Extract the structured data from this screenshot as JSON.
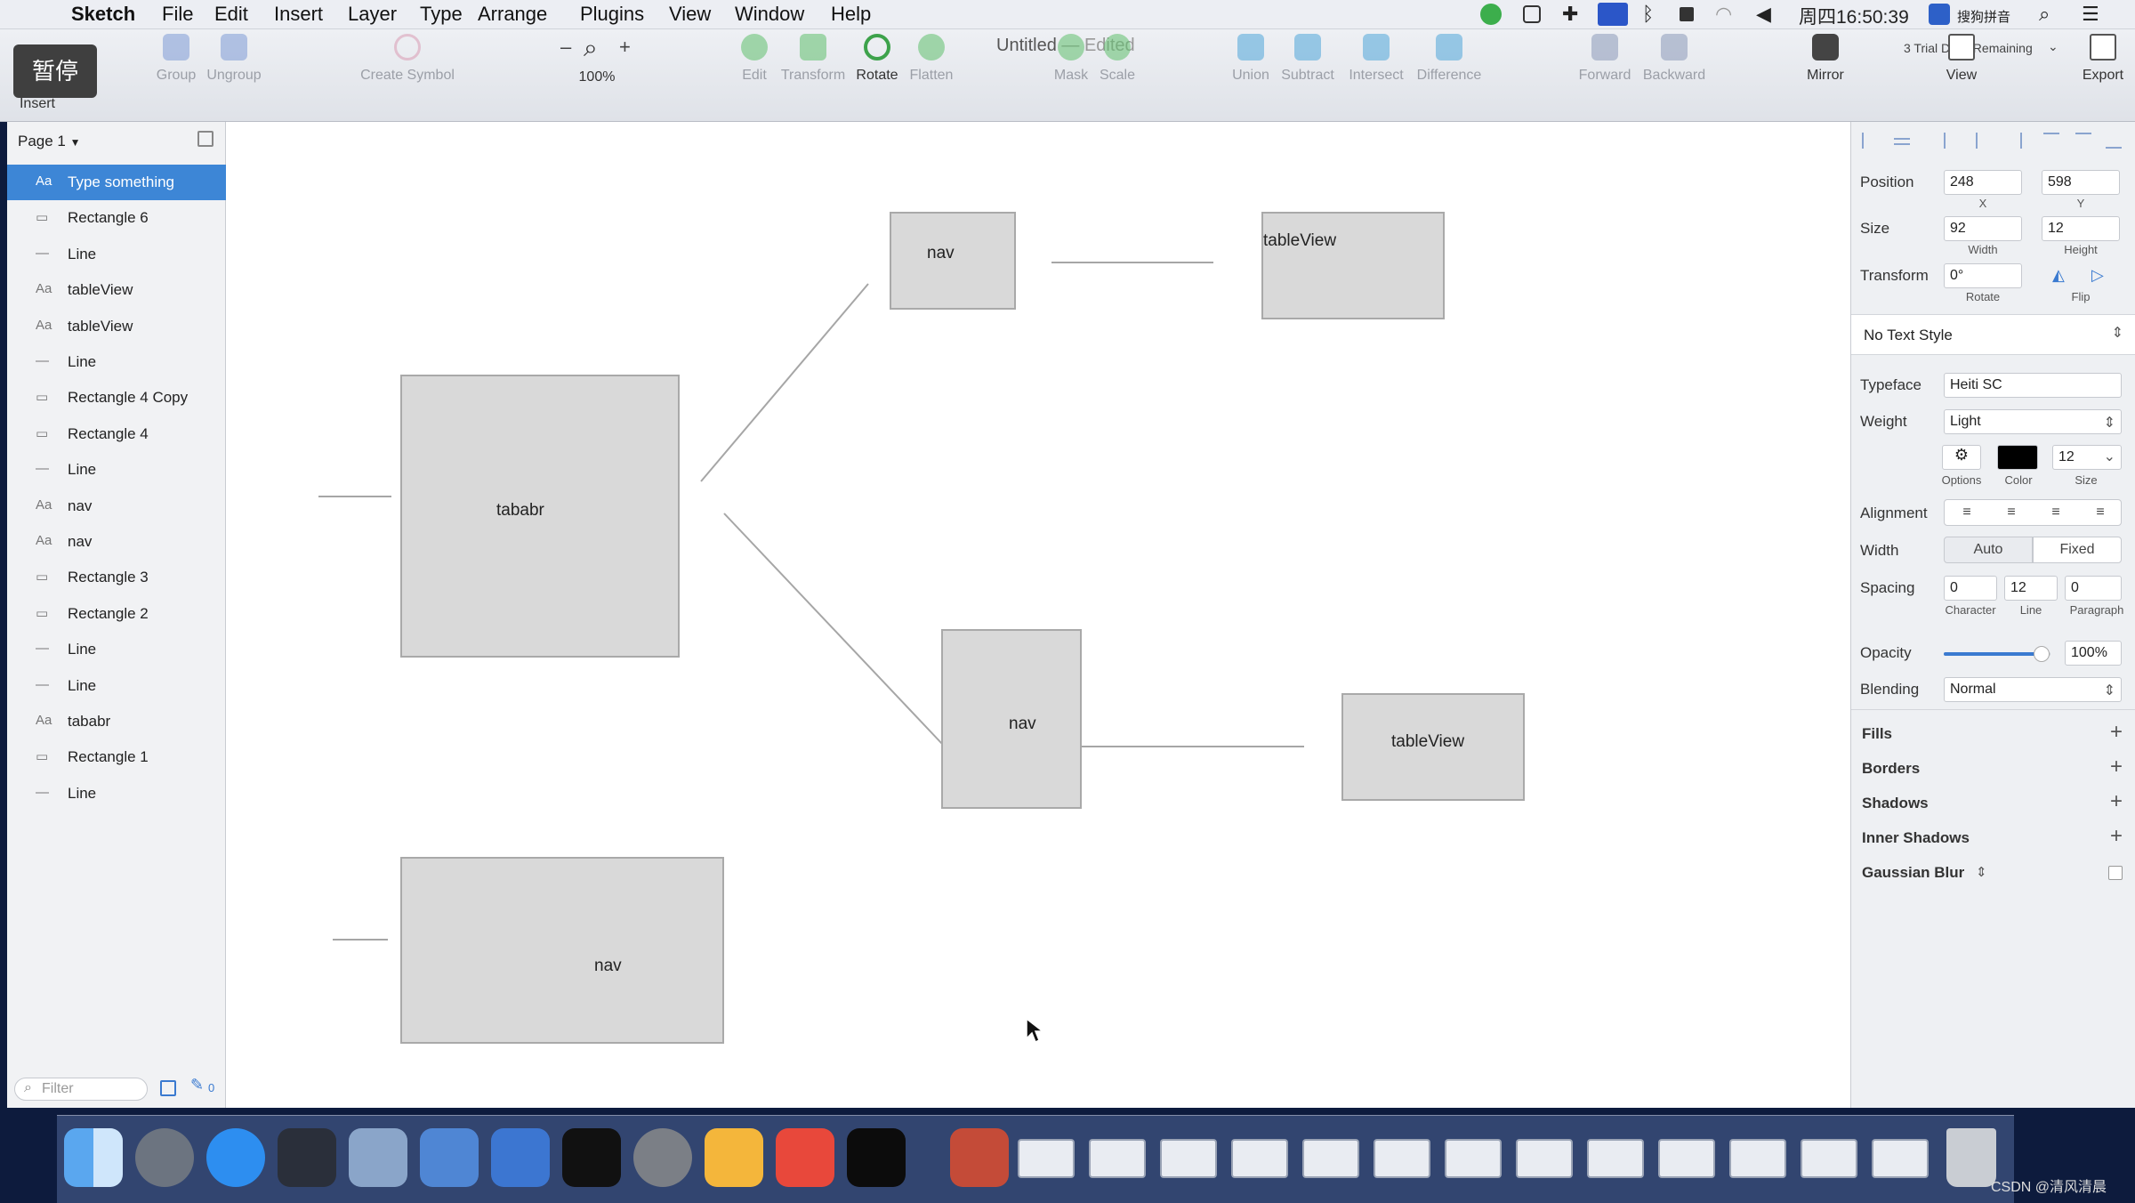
{
  "menubar": {
    "items": [
      "Sketch",
      "File",
      "Edit",
      "Insert",
      "Layer",
      "Type",
      "Arrange",
      "Plugins",
      "View",
      "Window",
      "Help"
    ],
    "clock": "周四16:50:39",
    "input_method": "搜狗拼音"
  },
  "window": {
    "title": "Untitled",
    "separator": "—",
    "edited": "Edited",
    "trial": "3 Trial Days Remaining"
  },
  "overlay": {
    "pause": "暂停"
  },
  "toolbar": {
    "insert": "Insert",
    "group": "Group",
    "ungroup": "Ungroup",
    "create_symbol": "Create Symbol",
    "zoom_minus": "–",
    "zoom_plus": "+",
    "zoom": "100%",
    "edit": "Edit",
    "transform": "Transform",
    "rotate": "Rotate",
    "flatten": "Flatten",
    "mask": "Mask",
    "scale": "Scale",
    "union": "Union",
    "subtract": "Subtract",
    "intersect": "Intersect",
    "difference": "Difference",
    "forward": "Forward",
    "backward": "Backward",
    "mirror": "Mirror",
    "view": "View",
    "export": "Export"
  },
  "layers": {
    "page": "Page 1",
    "filter_placeholder": "Filter",
    "filter_count": "0",
    "items": [
      {
        "name": "Type something",
        "kind": "text"
      },
      {
        "name": "Rectangle 6",
        "kind": "rect"
      },
      {
        "name": "Line",
        "kind": "line"
      },
      {
        "name": "tableView",
        "kind": "text"
      },
      {
        "name": "tableView",
        "kind": "text"
      },
      {
        "name": "Line",
        "kind": "line"
      },
      {
        "name": "Rectangle 4 Copy",
        "kind": "rect"
      },
      {
        "name": "Rectangle 4",
        "kind": "rect"
      },
      {
        "name": "Line",
        "kind": "line"
      },
      {
        "name": "nav",
        "kind": "text"
      },
      {
        "name": "nav",
        "kind": "text"
      },
      {
        "name": "Rectangle 3",
        "kind": "rect"
      },
      {
        "name": "Rectangle 2",
        "kind": "rect"
      },
      {
        "name": "Line",
        "kind": "line"
      },
      {
        "name": "Line",
        "kind": "line"
      },
      {
        "name": "tababr",
        "kind": "text"
      },
      {
        "name": "Rectangle 1",
        "kind": "rect"
      },
      {
        "name": "Line",
        "kind": "line"
      }
    ]
  },
  "canvas": {
    "tabbar_label": "tababr",
    "nav_top_label": "nav",
    "tableview_top_label": "tableView",
    "nav_mid_label": "nav",
    "tableview_mid_label": "tableView",
    "nav_bottom_label": "nav"
  },
  "inspector": {
    "position_label": "Position",
    "x": "248",
    "y": "598",
    "x_label": "X",
    "y_label": "Y",
    "size_label": "Size",
    "width": "92",
    "height": "12",
    "width_label": "Width",
    "height_label": "Height",
    "transform_label": "Transform",
    "rotate": "0°",
    "rotate_label": "Rotate",
    "flip_label": "Flip",
    "text_style": "No Text Style",
    "typeface_label": "Typeface",
    "typeface": "Heiti SC",
    "weight_label": "Weight",
    "weight": "Light",
    "options_label": "Options",
    "color_label": "Color",
    "font_color": "#000000",
    "size_small_label": "Size",
    "font_size": "12",
    "alignment_label": "Alignment",
    "width_mode_label": "Width",
    "width_auto": "Auto",
    "width_fixed": "Fixed",
    "spacing_label": "Spacing",
    "character": "0",
    "line": "12",
    "paragraph": "0",
    "character_label": "Character",
    "line_label": "Line",
    "paragraph_label": "Paragraph",
    "opacity_label": "Opacity",
    "opacity": "100%",
    "opacity_value": 1.0,
    "blending_label": "Blending",
    "blending": "Normal",
    "fills": "Fills",
    "borders": "Borders",
    "shadows": "Shadows",
    "inner_shadows": "Inner Shadows",
    "gaussian_blur": "Gaussian Blur"
  },
  "watermark": "CSDN @清风清晨"
}
